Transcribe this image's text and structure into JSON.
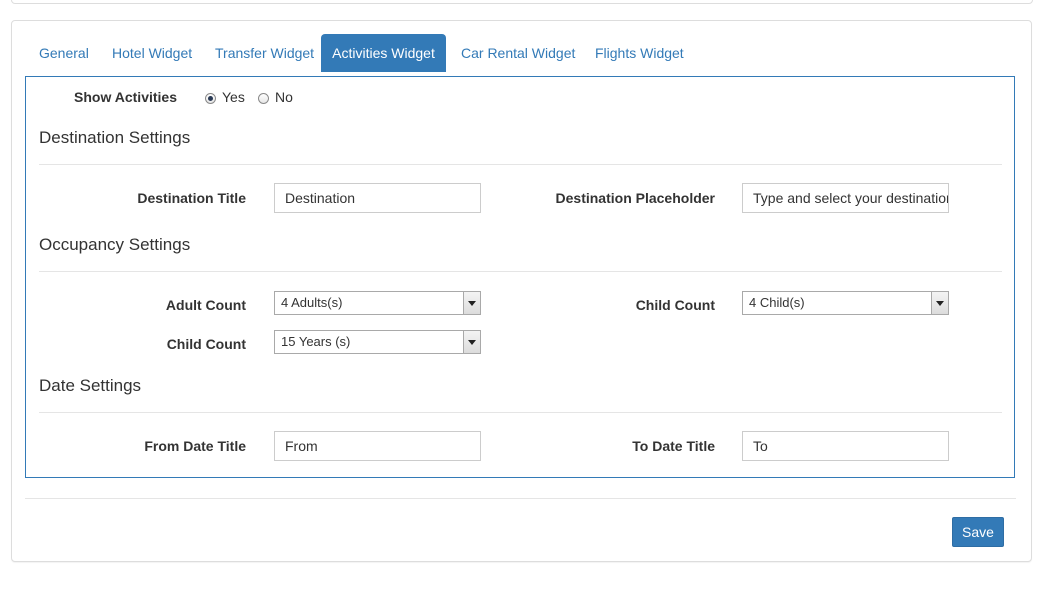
{
  "tabs": [
    {
      "label": "General",
      "active": false
    },
    {
      "label": "Hotel Widget",
      "active": false
    },
    {
      "label": "Transfer Widget",
      "active": false
    },
    {
      "label": "Activities Widget",
      "active": true
    },
    {
      "label": "Car Rental Widget",
      "active": false
    },
    {
      "label": "Flights Widget",
      "active": false
    }
  ],
  "show_activities": {
    "label": "Show Activities",
    "options": [
      {
        "label": "Yes",
        "checked": true
      },
      {
        "label": "No",
        "checked": false
      }
    ]
  },
  "destination": {
    "section_title": "Destination Settings",
    "title_label": "Destination Title",
    "title_value": "Destination",
    "placeholder_label": "Destination Placeholder",
    "placeholder_value": "Type and select your destinatior"
  },
  "occupancy": {
    "section_title": "Occupancy Settings",
    "adult_count_label": "Adult Count",
    "adult_count_value": "4 Adults(s)",
    "child_count_label": "Child Count",
    "child_count_value": "4 Child(s)",
    "child_age_label": "Child Count",
    "child_age_value": "15 Years (s)"
  },
  "dates": {
    "section_title": "Date Settings",
    "from_label": "From Date Title",
    "from_value": "From",
    "to_label": "To Date Title",
    "to_value": "To"
  },
  "footer": {
    "save_label": "Save"
  },
  "colors": {
    "accent": "#337ab7",
    "border": "#dddddd"
  }
}
